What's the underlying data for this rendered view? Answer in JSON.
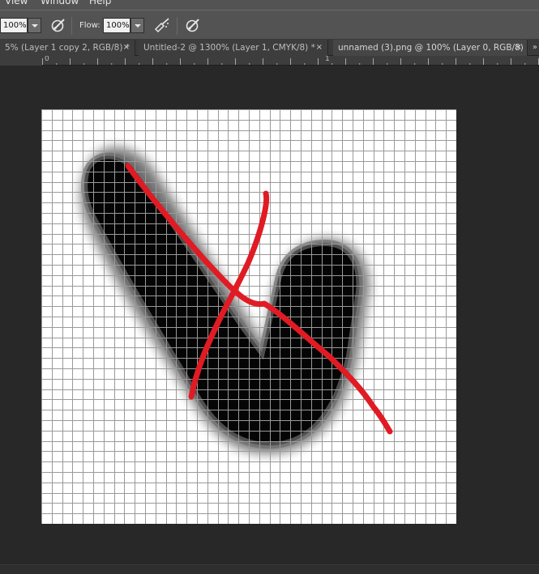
{
  "menu": {
    "view": "View",
    "window": "Window",
    "help": "Help"
  },
  "options": {
    "opacity_value": "100%",
    "flow_label": "Flow:",
    "flow_value": "100%"
  },
  "tabs": [
    {
      "label": "5% (Layer 1 copy 2, RGB/8) *",
      "close": "×"
    },
    {
      "label": "Untitled-2 @ 1300% (Layer 1, CMYK/8) *",
      "close": "×"
    },
    {
      "label": "unnamed (3).png @ 100% (Layer 0, RGB/8)",
      "close": "×"
    }
  ],
  "tab_scroll": "»",
  "ruler": {
    "label_0": "0",
    "label_1": "1"
  },
  "canvas": {
    "grid_size": 40,
    "background": "#ffffff",
    "grid_color": "#9a9a9a",
    "glyph_color": "#000000",
    "stroke_color": "#e01b24"
  },
  "colors": {
    "panel": "#535353",
    "workspace": "#282828",
    "tabbar": "#3a3a3a"
  }
}
